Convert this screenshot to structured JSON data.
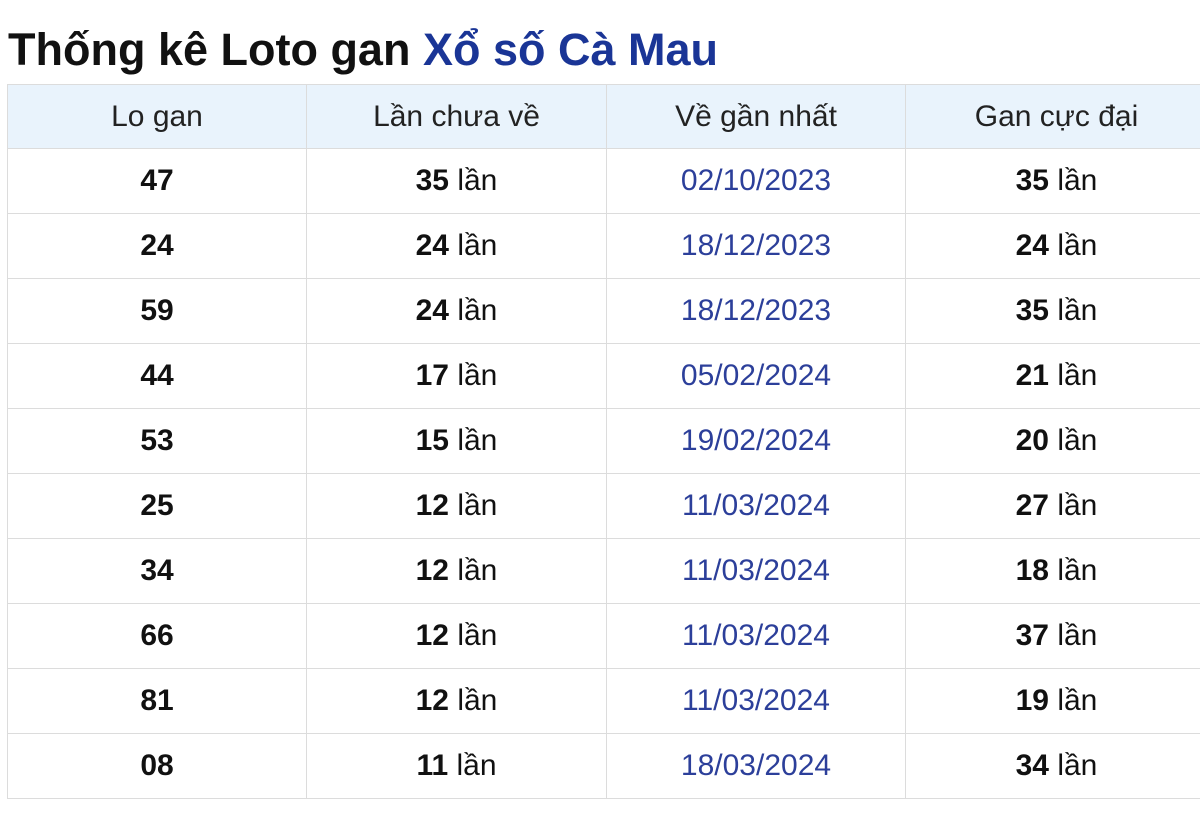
{
  "title": {
    "prefix": "Thống kê Loto gan",
    "place": "Xổ số Cà Mau"
  },
  "table": {
    "headers": [
      "Lo gan",
      "Lần chưa về",
      "Về gần nhất",
      "Gan cực đại"
    ],
    "unit": "lần",
    "rows": [
      {
        "lo": "47",
        "count": "35",
        "last": "02/10/2023",
        "max": "35"
      },
      {
        "lo": "24",
        "count": "24",
        "last": "18/12/2023",
        "max": "24"
      },
      {
        "lo": "59",
        "count": "24",
        "last": "18/12/2023",
        "max": "35"
      },
      {
        "lo": "44",
        "count": "17",
        "last": "05/02/2024",
        "max": "21"
      },
      {
        "lo": "53",
        "count": "15",
        "last": "19/02/2024",
        "max": "20"
      },
      {
        "lo": "25",
        "count": "12",
        "last": "11/03/2024",
        "max": "27"
      },
      {
        "lo": "34",
        "count": "12",
        "last": "11/03/2024",
        "max": "18"
      },
      {
        "lo": "66",
        "count": "12",
        "last": "11/03/2024",
        "max": "37"
      },
      {
        "lo": "81",
        "count": "12",
        "last": "11/03/2024",
        "max": "19"
      },
      {
        "lo": "08",
        "count": "11",
        "last": "18/03/2024",
        "max": "34"
      }
    ]
  },
  "colors": {
    "title_text": "#111111",
    "title_place": "#1a3596",
    "header_bg": "#e9f3fc",
    "date_text": "#2c3f9a",
    "border": "#dcdcdc"
  }
}
